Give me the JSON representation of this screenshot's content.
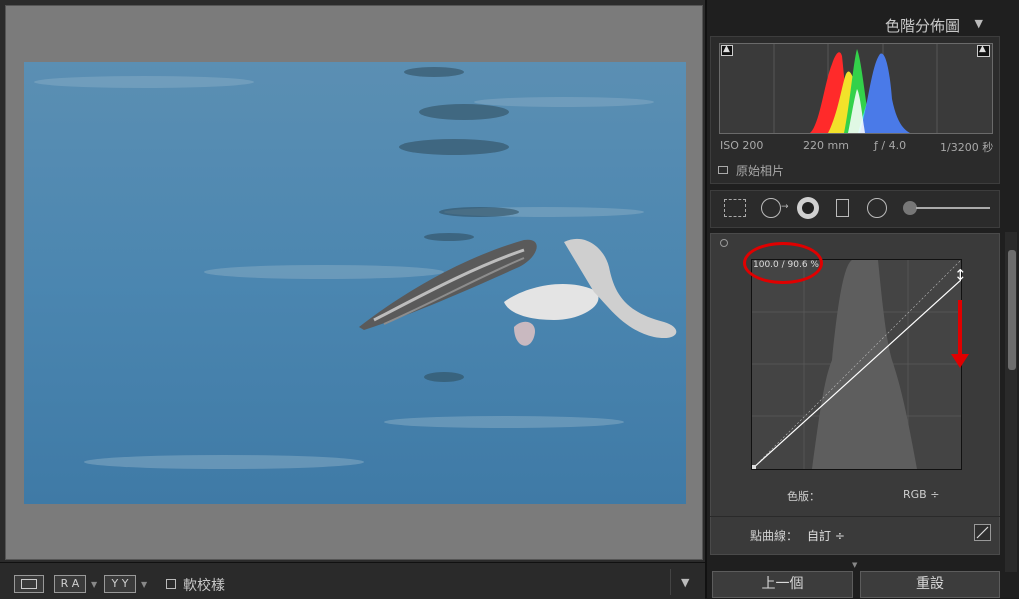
{
  "panel": {
    "title": "色階分佈圖",
    "collapse_icon": "▼"
  },
  "histogram": {
    "iso": "ISO 200",
    "focal": "220 mm",
    "aperture": "ƒ / 4.0",
    "shutter": "1/3200 秒",
    "original_photo_label": "原始相片",
    "colors": {
      "red": "#ff2a2a",
      "green": "#33d14a",
      "blue": "#4a7ae8",
      "yellow": "#f2e22a",
      "cyan": "#3fe0e0"
    }
  },
  "tone_curve": {
    "readout": "100.0 / 90.6 %",
    "channel_label": "色版：",
    "channel_value": "RGB ÷",
    "point_curve_label": "點曲線：",
    "point_curve_value": "自訂 ÷",
    "annotation_color": "#e00000"
  },
  "toolbar": {
    "soft_proof_label": "軟校樣",
    "ra_label": "R A",
    "yy_label": "Y Y"
  },
  "buttons": {
    "previous": "上一個",
    "reset": "重設"
  }
}
